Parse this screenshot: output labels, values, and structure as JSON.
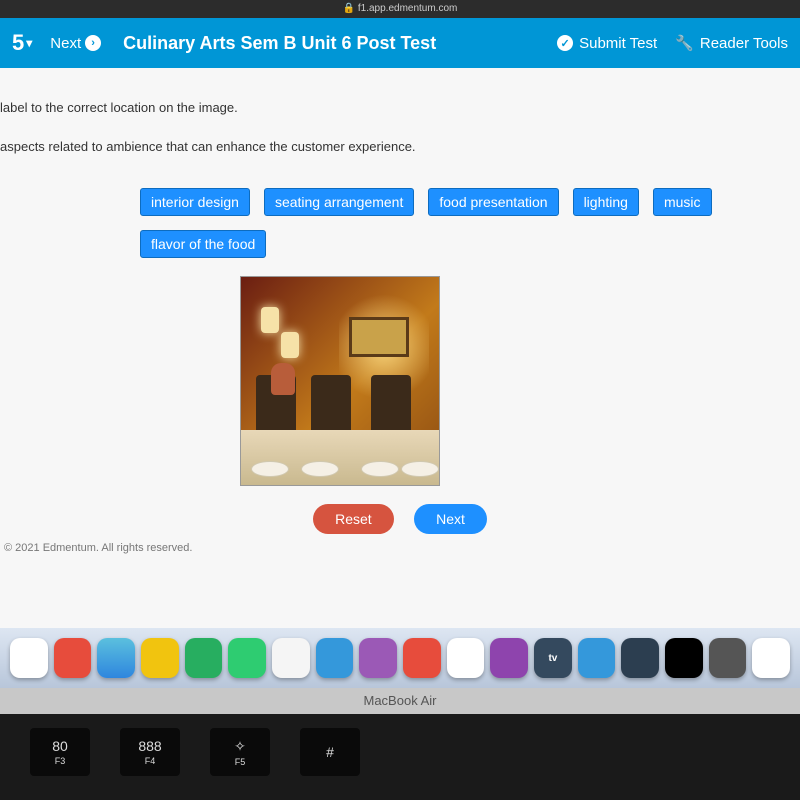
{
  "browser": {
    "url": "f1.app.edmentum.com"
  },
  "header": {
    "question_number": "5",
    "next_label": "Next",
    "title": "Culinary Arts Sem B Unit 6 Post Test",
    "submit_label": "Submit Test",
    "tools_label": "Reader Tools"
  },
  "question": {
    "instruction_line1": "label to the correct location on the image.",
    "instruction_line2": "aspects related to ambience that can enhance the customer experience.",
    "tags": [
      "interior design",
      "seating arrangement",
      "food presentation",
      "lighting",
      "music",
      "flavor of the food"
    ],
    "image_alt": "restaurant-interior"
  },
  "buttons": {
    "reset": "Reset",
    "next": "Next"
  },
  "footer": {
    "copyright": "© 2021 Edmentum. All rights reserved."
  },
  "dock": {
    "tv_label": "tv"
  },
  "laptop": {
    "model": "MacBook Air"
  },
  "keyboard": {
    "keys": [
      {
        "sym": "80",
        "label": "F3"
      },
      {
        "sym": "888",
        "label": "F4"
      },
      {
        "sym": "✧",
        "label": "F5"
      }
    ],
    "hash": "#"
  }
}
